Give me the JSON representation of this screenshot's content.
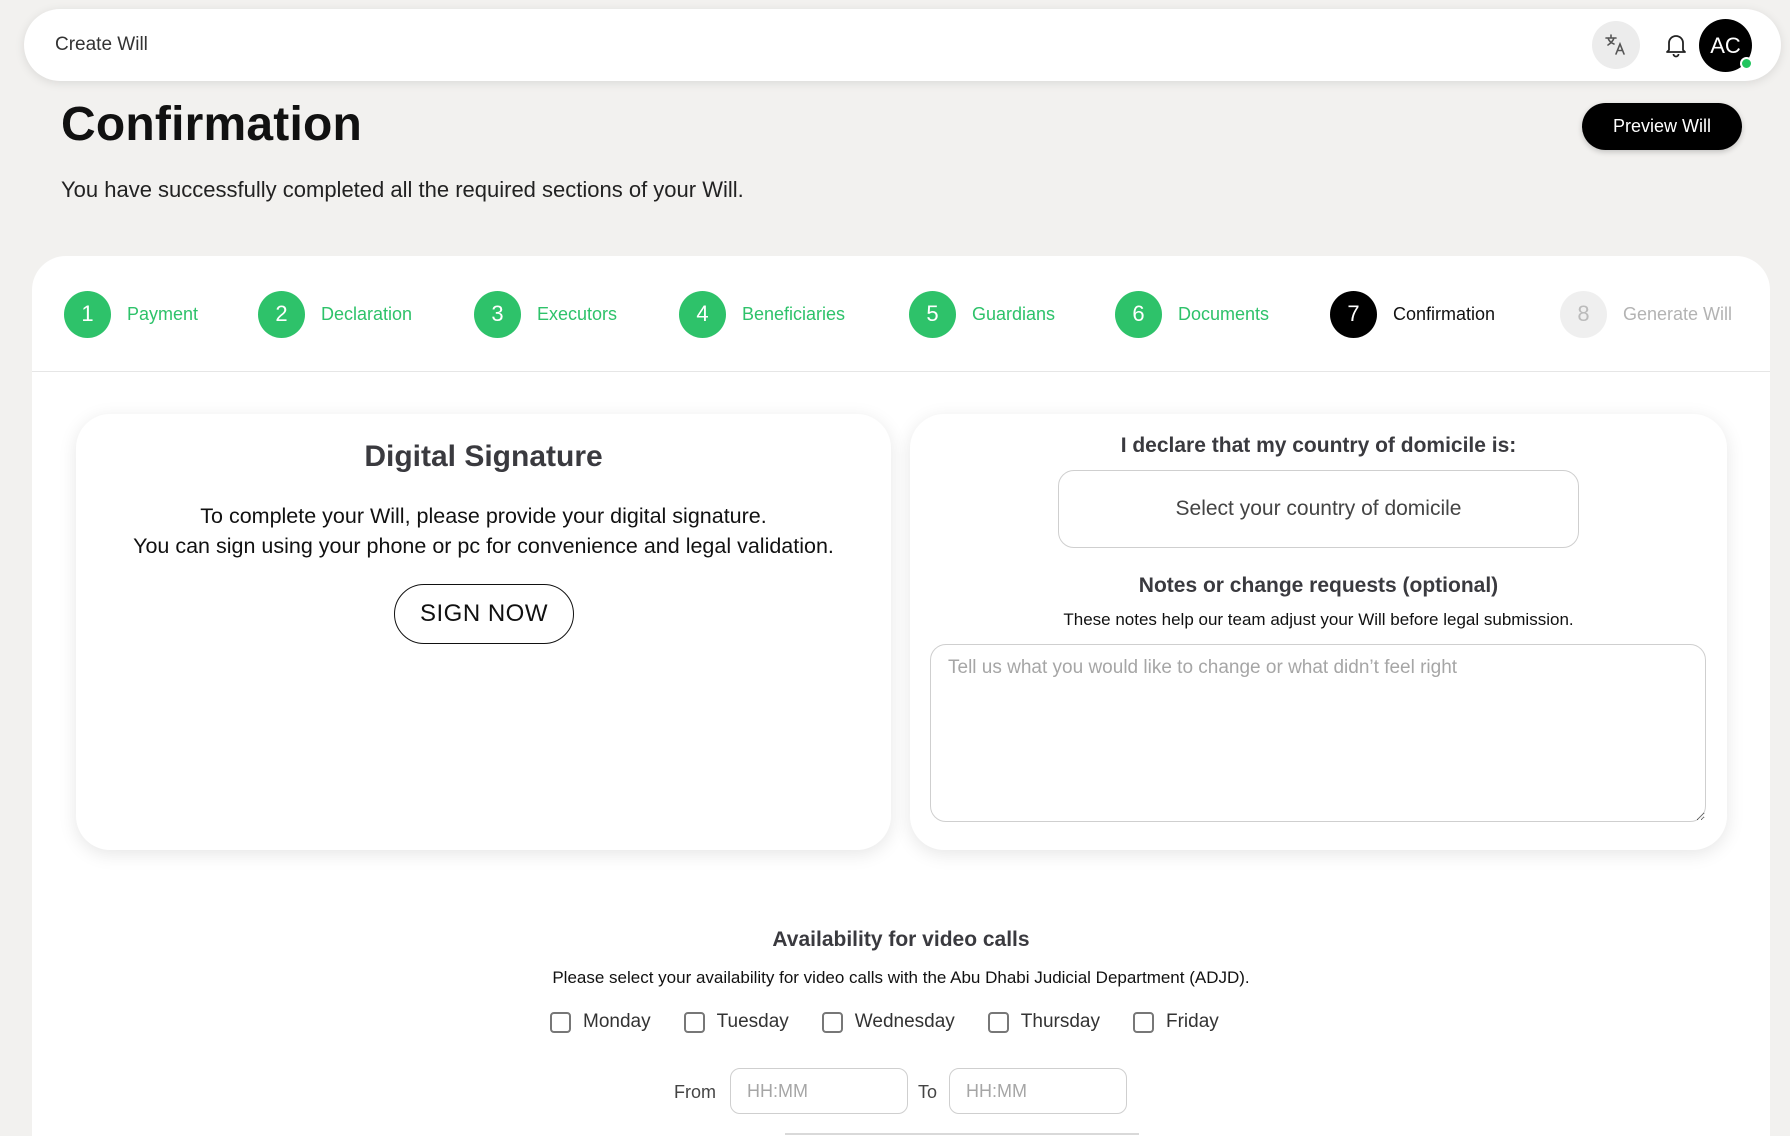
{
  "topbar": {
    "title": "Create Will",
    "translate_icon": "translate-icon",
    "bell_icon": "bell-icon",
    "avatar_initials": "AC"
  },
  "header": {
    "title": "Confirmation",
    "subtitle": "You have successfully completed all the required sections of your Will.",
    "preview_button": "Preview Will"
  },
  "steps": [
    {
      "num": "1",
      "label": "Payment",
      "state": "done"
    },
    {
      "num": "2",
      "label": "Declaration",
      "state": "done"
    },
    {
      "num": "3",
      "label": "Executors",
      "state": "done"
    },
    {
      "num": "4",
      "label": "Beneficiaries",
      "state": "done"
    },
    {
      "num": "5",
      "label": "Guardians",
      "state": "done"
    },
    {
      "num": "6",
      "label": "Documents",
      "state": "done"
    },
    {
      "num": "7",
      "label": "Confirmation",
      "state": "active"
    },
    {
      "num": "8",
      "label": "Generate Will",
      "state": "pending"
    }
  ],
  "signature": {
    "title": "Digital Signature",
    "line1": "To complete your Will, please provide your digital signature.",
    "line2": "You can sign using your phone or pc for convenience and legal validation.",
    "button": "SIGN NOW"
  },
  "declaration": {
    "question": "I declare that my country of domicile is:",
    "country_placeholder": "Select your country of domicile",
    "notes_title": "Notes or change requests (optional)",
    "notes_help": "These notes help our team adjust your Will before legal submission.",
    "notes_placeholder": "Tell us what you would like to change or what didn’t feel right",
    "notes_value": ""
  },
  "availability": {
    "title": "Availability for video calls",
    "help": "Please select your availability for video calls with the Abu Dhabi Judicial Department (ADJD).",
    "days": [
      {
        "label": "Monday",
        "checked": false
      },
      {
        "label": "Tuesday",
        "checked": false
      },
      {
        "label": "Wednesday",
        "checked": false
      },
      {
        "label": "Thursday",
        "checked": false
      },
      {
        "label": "Friday",
        "checked": false
      }
    ],
    "from_label": "From",
    "to_label": "To",
    "from_placeholder": "HH:MM",
    "to_placeholder": "HH:MM"
  },
  "colors": {
    "accent_green": "#2ec26a",
    "active_step": "#000000",
    "pending_step": "#efefef",
    "status_online": "#22c55e"
  }
}
